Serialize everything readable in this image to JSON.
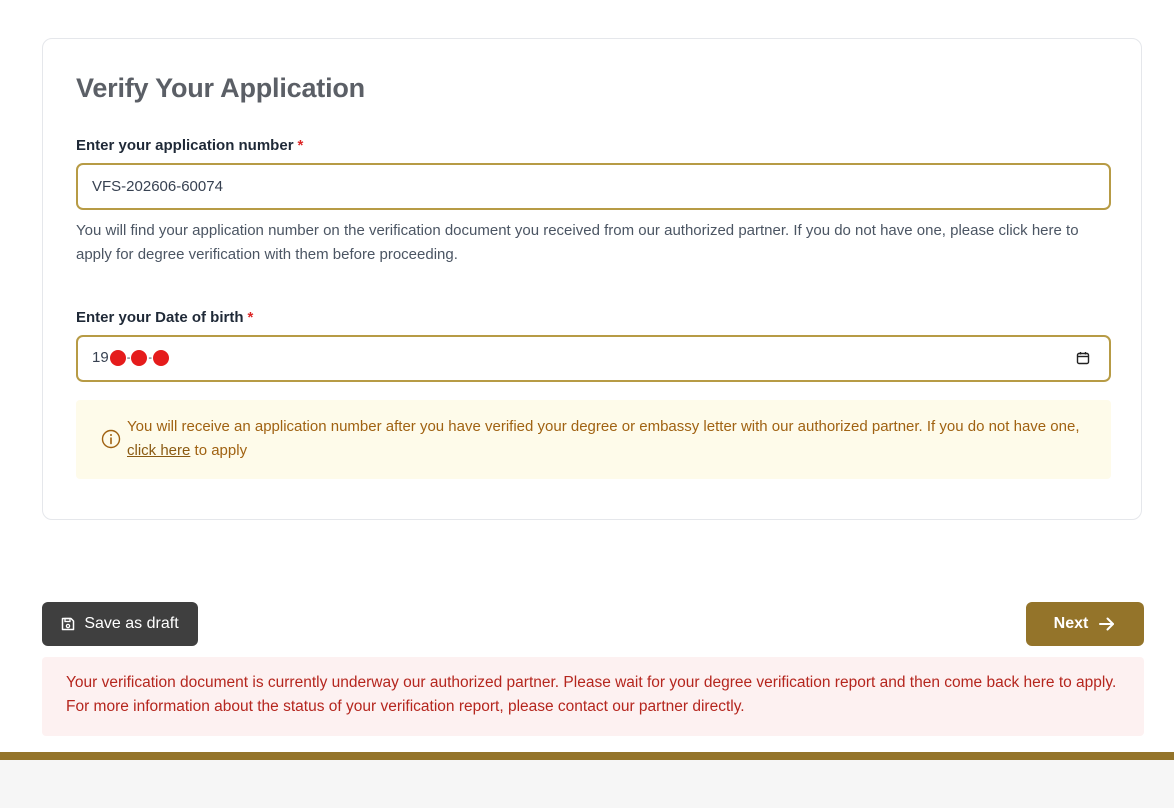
{
  "form": {
    "title": "Verify Your Application",
    "application_number": {
      "label": "Enter your application number",
      "required_mark": "*",
      "value": "VFS-202606-60074",
      "help": "You will find your application number on the verification document you received from our authorized partner. If you do not have one, please click here to apply for degree verification with them before proceeding."
    },
    "dob": {
      "label": "Enter your Date of birth",
      "required_mark": "*",
      "value_prefix": "19",
      "separator": "-"
    },
    "notice": {
      "text_before": "You will receive an application number after you have verified your degree or embassy letter with our authorized partner. If you do not have one, ",
      "link": "click here",
      "text_after": " to apply"
    }
  },
  "actions": {
    "save_draft": "Save as draft",
    "next": "Next"
  },
  "alert": {
    "text": "Your verification document is currently underway our authorized partner. Please wait for your degree verification report and then come back here to apply. For more information about the status of your verification report, please contact our partner directly."
  },
  "colors": {
    "accent": "#94742a",
    "field_border": "#b79b45",
    "required": "#dc2626",
    "notice_bg": "#fefbea",
    "notice_text": "#a06212",
    "alert_bg": "#fdf1f1",
    "alert_text": "#b5261e",
    "draft_button": "#3f3f3f",
    "redaction": "#e51c1c"
  },
  "icons": {
    "calendar": "calendar-icon",
    "info": "info-icon",
    "save": "floppy-disk-icon",
    "next": "arrow-right-icon"
  }
}
